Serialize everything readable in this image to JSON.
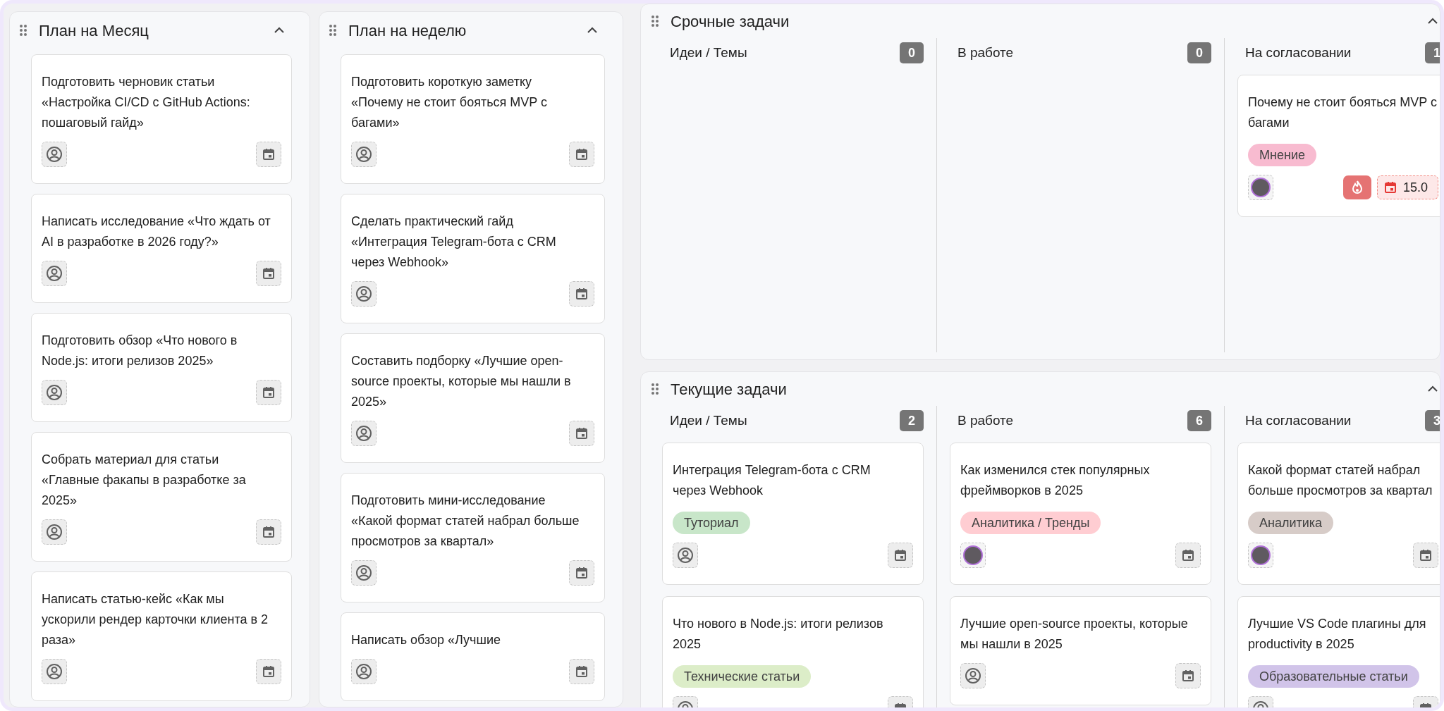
{
  "plans": [
    {
      "title": "План на Месяц",
      "cards": [
        {
          "title": "Подготовить черновик статьи «Настройка CI/CD с GitHub Actions: пошаговый гайд»",
          "assigned": false
        },
        {
          "title": "Написать исследование «Что ждать от AI в разработке в 2026 году?»",
          "assigned": false
        },
        {
          "title": "Подготовить обзор «Что нового в Node.js: итоги релизов 2025»",
          "assigned": false
        },
        {
          "title": "Собрать материал для статьи «Главные факапы в разработке за 2025»",
          "assigned": false
        },
        {
          "title": "Написать статью-кейс «Как мы ускорили рендер карточки клиента в 2 раза»",
          "assigned": false
        }
      ]
    },
    {
      "title": "План на неделю",
      "cards": [
        {
          "title": "Подготовить короткую заметку «Почему не стоит бояться MVP с багами»",
          "assigned": false
        },
        {
          "title": "Сделать практический гайд «Интеграция Telegram-бота с CRM через Webhook»",
          "assigned": false
        },
        {
          "title": "Составить подборку «Лучшие open-source проекты, которые мы нашли в 2025»",
          "assigned": false
        },
        {
          "title": "Подготовить мини-исследование «Какой формат статей набрал больше просмотров за квартал»",
          "assigned": false
        },
        {
          "title": "Написать обзор «Лучшие",
          "assigned": false
        }
      ]
    }
  ],
  "sections": [
    {
      "title": "Срочные задачи",
      "columns": [
        {
          "title": "Идеи / Темы",
          "count": "0"
        },
        {
          "title": "В работе",
          "count": "0"
        },
        {
          "title": "На согласовании",
          "count": "1",
          "cards": [
            {
              "title": "Почему не стоит бояться MVP с багами",
              "tags": [
                {
                  "label": "Мнение",
                  "color": "#f8bbd0"
                }
              ],
              "assigned": true,
              "hot": true,
              "due": "15.0"
            }
          ]
        }
      ]
    },
    {
      "title": "Текущие задачи",
      "columns": [
        {
          "title": "Идеи / Темы",
          "count": "2",
          "cards": [
            {
              "title": "Интеграция Telegram-бота с CRM через Webhook",
              "tags": [
                {
                  "label": "Туториал",
                  "color": "#c8e6c9"
                }
              ],
              "assigned": false,
              "hot": false
            },
            {
              "title": "Что нового в Node.js: итоги релизов 2025",
              "tags": [
                {
                  "label": "Технические статьи",
                  "color": "#dcedc8"
                }
              ],
              "assigned": false,
              "hot": false
            }
          ]
        },
        {
          "title": "В работе",
          "count": "6",
          "cards": [
            {
              "title": "Как изменился стек популярных фреймворков в 2025",
              "tags": [
                {
                  "label": "Аналитика / Тренды",
                  "color": "#ffcdd2"
                }
              ],
              "assigned": true,
              "hot": false
            },
            {
              "title": "Лучшие open-source проекты, которые мы нашли в 2025",
              "assigned": false,
              "hot": false
            }
          ]
        },
        {
          "title": "На согласовании",
          "count": "3",
          "cards": [
            {
              "title": "Какой формат статей набрал больше просмотров за квартал",
              "tags": [
                {
                  "label": "Аналитика",
                  "color": "#d7ccc8"
                }
              ],
              "assigned": true,
              "hot": false
            },
            {
              "title": "Лучшие VS Code плагины для productivity в 2025",
              "tags": [
                {
                  "label": "Образовательные статьи",
                  "color": "#d1c4e9"
                }
              ],
              "assigned": false,
              "hot": false
            }
          ]
        }
      ]
    }
  ]
}
